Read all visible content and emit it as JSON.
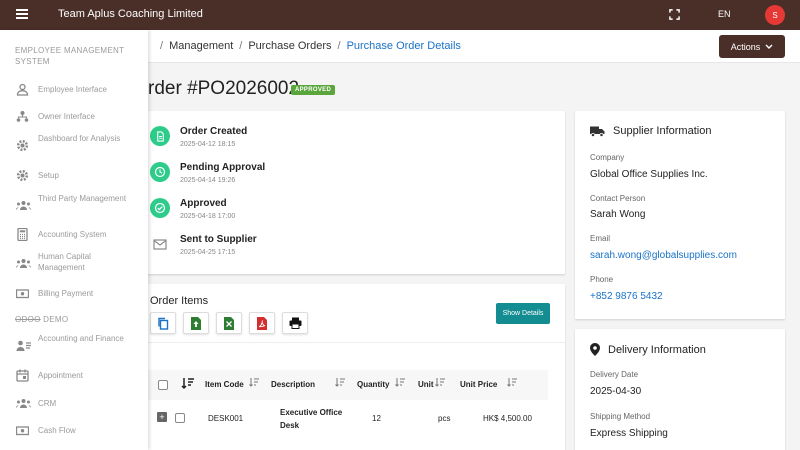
{
  "topbar": {
    "title": "Team Aplus Coaching Limited",
    "lang": "EN",
    "avatar_initial": "S"
  },
  "breadcrumb": {
    "items": [
      "Management",
      "Purchase Orders",
      "Purchase Order Details"
    ],
    "sep": "/"
  },
  "actions_label": "Actions",
  "page": {
    "title": "rder #PO2026002",
    "status": "APPROVED"
  },
  "timeline": [
    {
      "title": "Order Created",
      "date": "2025-04-12 18:15"
    },
    {
      "title": "Pending Approval",
      "date": "2025-04-14 19:26"
    },
    {
      "title": "Approved",
      "date": "2025-04-18 17:00"
    },
    {
      "title": "Sent to Supplier",
      "date": "2025-04-25 17:15"
    }
  ],
  "order_items": {
    "title": "Order Items",
    "show_details_label": "Show Details",
    "columns": [
      "Item Code",
      "Description",
      "Quantity",
      "Unit",
      "Unit Price"
    ],
    "rows": [
      {
        "code": "DESK001",
        "description_line1": "Executive Office",
        "description_line2": "Desk",
        "quantity": "12",
        "unit": "pcs",
        "unit_price": "HK$ 4,500.00"
      }
    ]
  },
  "supplier": {
    "heading": "Supplier Information",
    "company_label": "Company",
    "company": "Global Office Supplies Inc.",
    "contact_label": "Contact Person",
    "contact": "Sarah Wong",
    "email_label": "Email",
    "email": "sarah.wong@globalsupplies.com",
    "phone_label": "Phone",
    "phone": "+852 9876 5432"
  },
  "delivery": {
    "heading": "Delivery Information",
    "date_label": "Delivery Date",
    "date": "2025-04-30",
    "method_label": "Shipping Method",
    "method": "Express Shipping"
  },
  "sidebar": {
    "section1": "EMPLOYEE MANAGEMENT SYSTEM",
    "items1": [
      "Employee Interface",
      "Owner Interface",
      "Dashboard for Analysis",
      "Setup",
      "Third Party Management",
      "Accounting System",
      "Human Capital Management",
      "Billing Payment"
    ],
    "section2_strike": "ODOO",
    "section2_rest": " DEMO",
    "items2": [
      "Accounting and Finance",
      "Appointment",
      "CRM",
      "Cash Flow"
    ]
  },
  "colors": {
    "topbar": "#4a2e28",
    "accent": "#1a73c8",
    "approved": "#5aa53c",
    "timeline": "#2ecc8a",
    "teal_button": "#138d92"
  }
}
